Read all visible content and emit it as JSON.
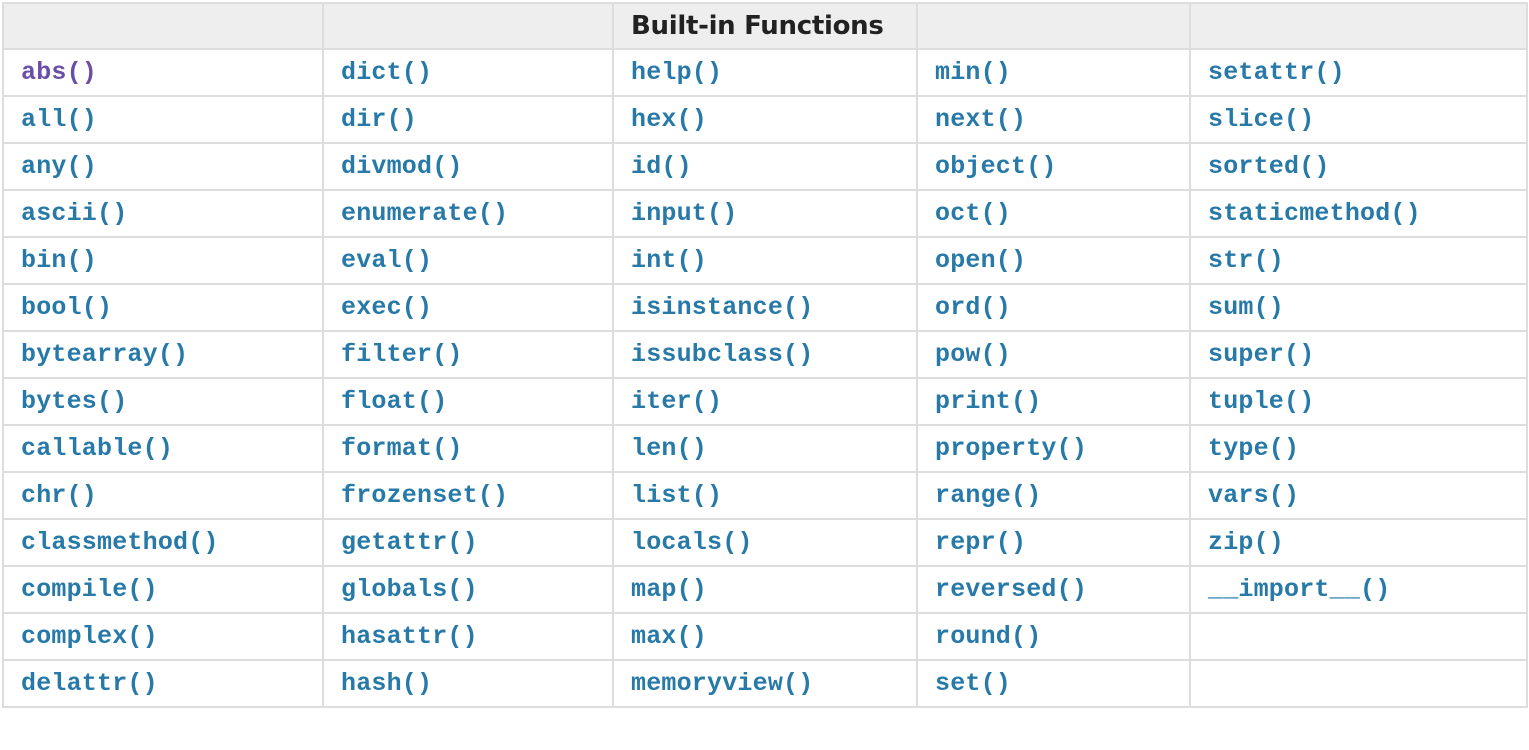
{
  "table": {
    "title": "Built-in Functions",
    "colors": {
      "link": "#2779a8",
      "visited_link": "#6a4fa8",
      "header_bg": "#eeeeee",
      "border": "#dddddd"
    },
    "visited": [
      "abs()"
    ],
    "columns": [
      [
        "abs()",
        "all()",
        "any()",
        "ascii()",
        "bin()",
        "bool()",
        "bytearray()",
        "bytes()",
        "callable()",
        "chr()",
        "classmethod()",
        "compile()",
        "complex()",
        "delattr()"
      ],
      [
        "dict()",
        "dir()",
        "divmod()",
        "enumerate()",
        "eval()",
        "exec()",
        "filter()",
        "float()",
        "format()",
        "frozenset()",
        "getattr()",
        "globals()",
        "hasattr()",
        "hash()"
      ],
      [
        "help()",
        "hex()",
        "id()",
        "input()",
        "int()",
        "isinstance()",
        "issubclass()",
        "iter()",
        "len()",
        "list()",
        "locals()",
        "map()",
        "max()",
        "memoryview()"
      ],
      [
        "min()",
        "next()",
        "object()",
        "oct()",
        "open()",
        "ord()",
        "pow()",
        "print()",
        "property()",
        "range()",
        "repr()",
        "reversed()",
        "round()",
        "set()"
      ],
      [
        "setattr()",
        "slice()",
        "sorted()",
        "staticmethod()",
        "str()",
        "sum()",
        "super()",
        "tuple()",
        "type()",
        "vars()",
        "zip()",
        "__import__()",
        "",
        ""
      ]
    ]
  }
}
